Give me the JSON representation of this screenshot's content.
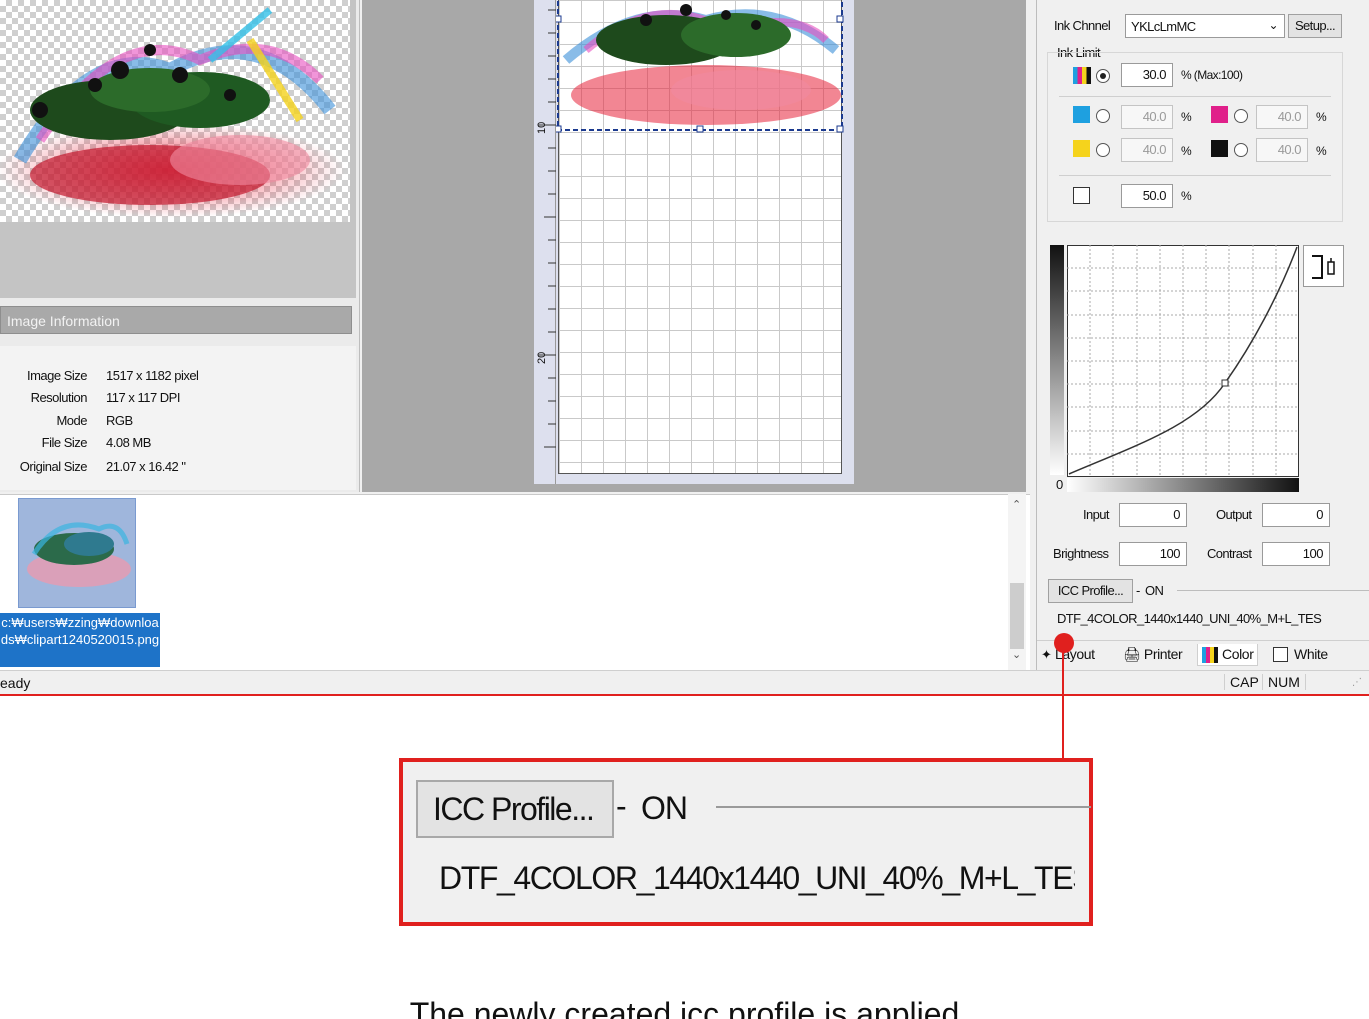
{
  "image_info": {
    "header": "Image Information",
    "rows": [
      {
        "label": "Image Size",
        "value": "1517 x 1182 pixel"
      },
      {
        "label": "Resolution",
        "value": "117 x 117 DPI"
      },
      {
        "label": "Mode",
        "value": "RGB"
      },
      {
        "label": "File Size",
        "value": "4.08 MB"
      },
      {
        "label": "Original Size",
        "value": "21.07 x 16.42 \""
      }
    ]
  },
  "ruler": {
    "marks": [
      "10",
      "20"
    ]
  },
  "thumbnail": {
    "path_label": "c:₩users₩zzing₩downloads₩clipart1240520015.png"
  },
  "status": {
    "left": "eady",
    "cap": "CAP",
    "num": "NUM"
  },
  "ink": {
    "channel_label": "Ink Chnnel",
    "channel_value": "YKLcLmMC",
    "setup_button": "Setup...",
    "limit_label": "Ink Limit",
    "total_value": "30.0",
    "total_unit": "% (Max:100)",
    "cyan_value": "40.0",
    "magenta_value": "40.0",
    "yellow_value": "40.0",
    "black_value": "40.0",
    "white_value": "50.0",
    "percent": "%"
  },
  "curve": {
    "zero_label": "0",
    "input_label": "Input",
    "input_value": "0",
    "output_label": "Output",
    "output_value": "0",
    "brightness_label": "Brightness",
    "brightness_value": "100",
    "contrast_label": "Contrast",
    "contrast_value": "100"
  },
  "icc": {
    "button": "ICC Profile...",
    "state": "ON",
    "profile_name": "DTF_4COLOR_1440x1440_UNI_40%_M+L_TES"
  },
  "tabs": [
    {
      "label": "Layout"
    },
    {
      "label": "Printer"
    },
    {
      "label": "Color"
    },
    {
      "label": "White"
    }
  ],
  "colors": {
    "accent": "#e0201e",
    "selection": "#1e73c8"
  },
  "caption": "The newly created icc profile is applied"
}
